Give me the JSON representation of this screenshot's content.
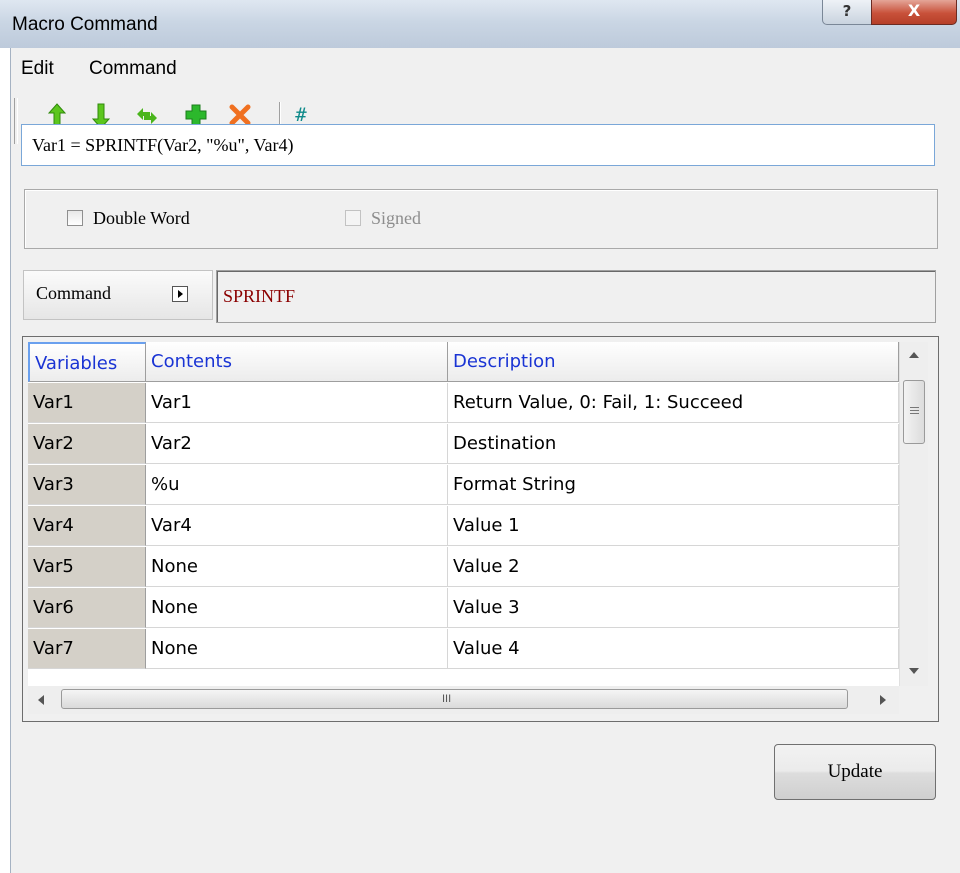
{
  "window": {
    "title": "Macro Command",
    "help_glyph": "?",
    "close_glyph": "X"
  },
  "menu": {
    "items": [
      "Edit",
      "Command"
    ]
  },
  "toolbar": {
    "buttons": [
      "move-up-icon",
      "move-down-icon",
      "swap-icon",
      "add-icon",
      "delete-icon"
    ],
    "extra": {
      "icon": "hash-icon",
      "glyph": "#"
    }
  },
  "command_text": "Var1 = SPRINTF(Var2, \"%u\", Var4)",
  "options": {
    "double_word": {
      "label": "Double Word",
      "checked": false,
      "enabled": true
    },
    "signed": {
      "label": "Signed",
      "checked": false,
      "enabled": false
    }
  },
  "command": {
    "button_label": "Command",
    "value": "SPRINTF"
  },
  "grid": {
    "headers": [
      "Variables",
      "Contents",
      "Description"
    ],
    "rows": [
      [
        "Var1",
        "Var1",
        "Return Value, 0: Fail, 1: Succeed"
      ],
      [
        "Var2",
        "Var2",
        "Destination"
      ],
      [
        "Var3",
        "%u",
        "Format String"
      ],
      [
        "Var4",
        "Var4",
        "Value 1"
      ],
      [
        "Var5",
        "None",
        "Value 2"
      ],
      [
        "Var6",
        "None",
        "Value 3"
      ],
      [
        "Var7",
        "None",
        "Value 4"
      ]
    ],
    "scroll_glyph": "III"
  },
  "update_button": "Update",
  "colors": {
    "header_text": "#1a34d4",
    "command_value": "#8b0000",
    "close_button": "#c8513a",
    "add_icon": "#22aa22",
    "delete_icon": "#f07020",
    "arrow_icon": "#44b81a"
  }
}
